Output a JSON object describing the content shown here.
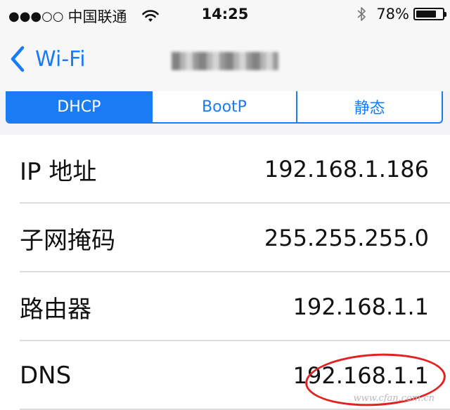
{
  "status_bar": {
    "signal_dots": "●●●○○",
    "carrier": "中国联通",
    "time": "14:25",
    "battery_percent": "78%",
    "battery_level": 0.78,
    "icons": [
      "wifi-icon",
      "bluetooth-icon",
      "battery-icon"
    ]
  },
  "nav": {
    "back_label": "Wi-Fi",
    "title_blurred": true
  },
  "segments": [
    {
      "label": "DHCP",
      "selected": true
    },
    {
      "label": "BootP",
      "selected": false
    },
    {
      "label": "静态",
      "selected": false
    }
  ],
  "rows": [
    {
      "label": "IP 地址",
      "value": "192.168.1.186"
    },
    {
      "label": "子网掩码",
      "value": "255.255.255.0"
    },
    {
      "label": "路由器",
      "value": "192.168.1.1"
    },
    {
      "label": "DNS",
      "value": "192.168.1.1"
    }
  ],
  "annotation_color": "#e22222",
  "accent_color": "#1a7cf5",
  "watermark": "www.cfan.com.cn"
}
